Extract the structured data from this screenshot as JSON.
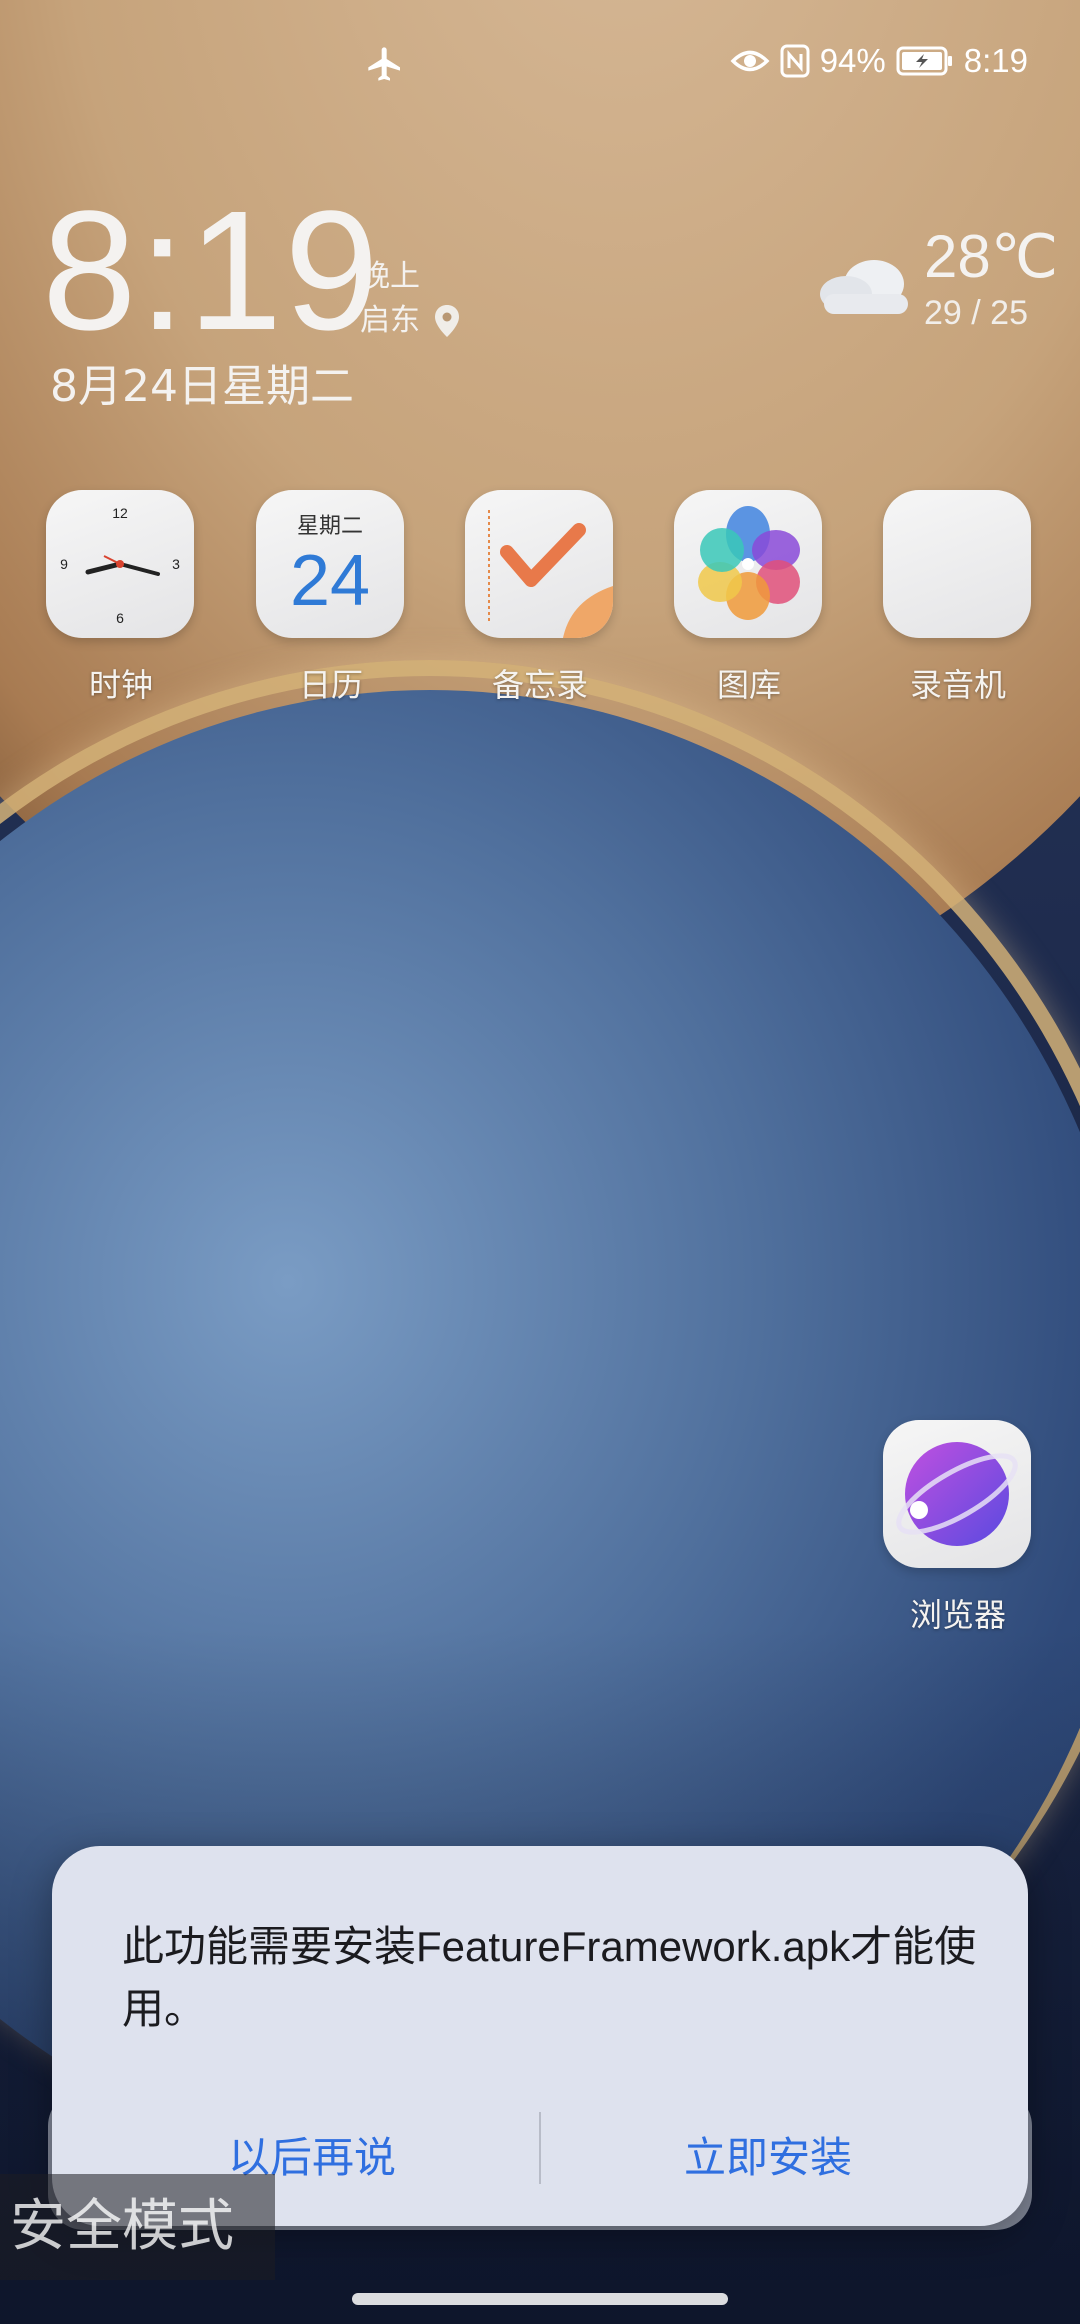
{
  "status_bar": {
    "battery_percent": "94%",
    "time": "8:19",
    "icons": [
      "airplane-mode-icon",
      "eye-comfort-icon",
      "nfc-icon",
      "battery-charging-icon"
    ]
  },
  "clock_widget": {
    "time": "8:19",
    "period": "晚上",
    "location": "启东",
    "date": "8月24日星期二"
  },
  "weather_widget": {
    "temperature": "28℃",
    "range": "29 / 25",
    "icon": "cloudy-icon"
  },
  "apps": [
    {
      "label": "时钟",
      "icon": "clock-icon"
    },
    {
      "label": "日历",
      "icon": "calendar-icon",
      "weekday": "星期二",
      "day": "24"
    },
    {
      "label": "备忘录",
      "icon": "notepad-icon"
    },
    {
      "label": "图库",
      "icon": "gallery-icon"
    },
    {
      "label": "录音机",
      "icon": "recorder-icon"
    },
    {
      "label": "浏览器",
      "icon": "browser-icon"
    }
  ],
  "clock_icon_numbers": [
    "12",
    "3",
    "6",
    "9"
  ],
  "dialog": {
    "message": "此功能需要安装FeatureFramework.apk才能使用。",
    "cancel_label": "以后再说",
    "confirm_label": "立即安装"
  },
  "safe_mode_label": "安全模式",
  "colors": {
    "accent": "#2f6fe0",
    "dialog_bg": "#dee2ee",
    "calendar_day": "#2f7ad6"
  }
}
